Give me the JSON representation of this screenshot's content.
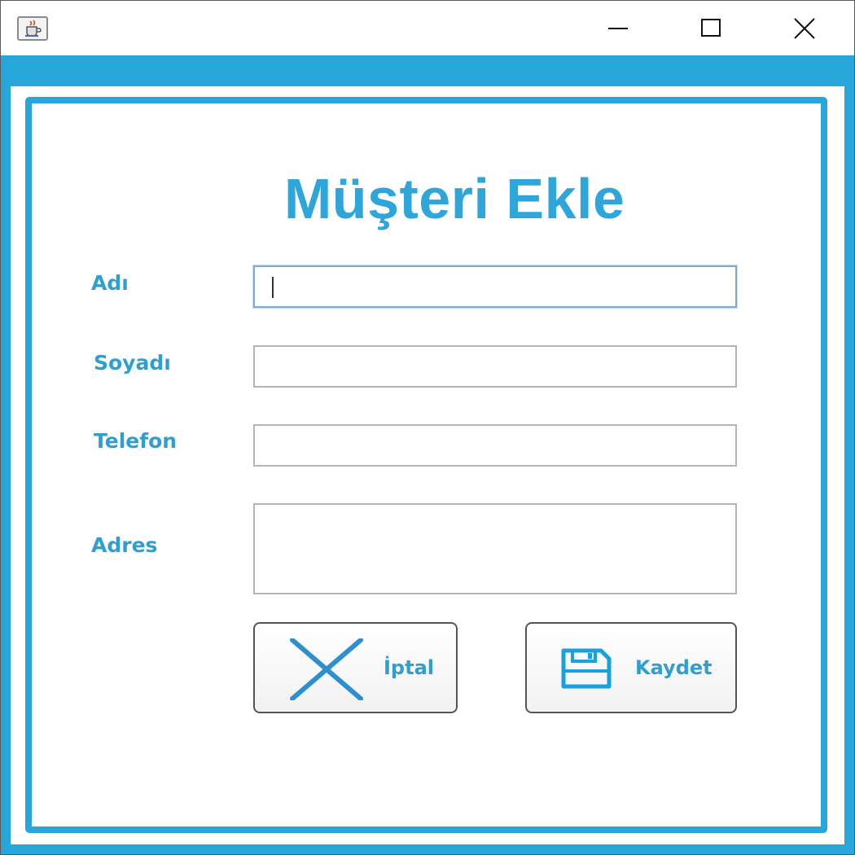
{
  "window": {
    "app_icon": "java-cup-icon",
    "controls": {
      "minimize_icon": "minimize-icon",
      "maximize_icon": "maximize-icon",
      "close_icon": "close-icon"
    }
  },
  "form": {
    "title": "Müşteri Ekle",
    "fields": {
      "adi": {
        "label": "Adı",
        "value": ""
      },
      "soyadi": {
        "label": "Soyadı",
        "value": ""
      },
      "telefon": {
        "label": "Telefon",
        "value": ""
      },
      "adres": {
        "label": "Adres",
        "value": ""
      }
    },
    "buttons": {
      "cancel": {
        "label": "İptal",
        "icon": "x-cross-icon"
      },
      "save": {
        "label": "Kaydet",
        "icon": "floppy-disk-icon"
      }
    }
  },
  "colors": {
    "accent": "#26a6d9",
    "text_accent": "#2e9fd0"
  }
}
